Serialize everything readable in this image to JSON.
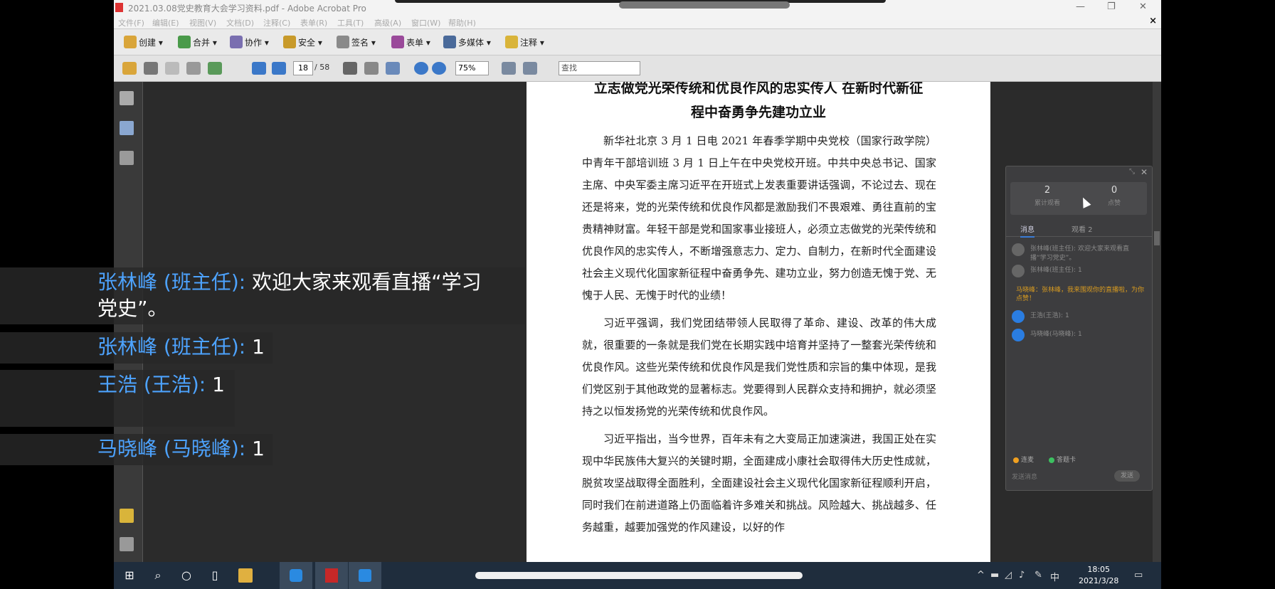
{
  "window": {
    "title": "2021.03.08党史教育大会学习资料.pdf - Adobe Acrobat Pro",
    "min_label": "—",
    "max_label": "❐",
    "close_label": "✕"
  },
  "menubar": {
    "items": [
      "文件(F)",
      "编辑(E)",
      "视图(V)",
      "文档(D)",
      "注释(C)",
      "表单(R)",
      "工具(T)",
      "高级(A)",
      "窗口(W)",
      "帮助(H)"
    ],
    "close_label": "×"
  },
  "toolbar1": {
    "items": [
      {
        "label": "创建 ▾",
        "icon": "create-icon"
      },
      {
        "label": "合并 ▾",
        "icon": "merge-icon"
      },
      {
        "label": "协作 ▾",
        "icon": "collaborate-icon"
      },
      {
        "label": "安全 ▾",
        "icon": "lock-icon"
      },
      {
        "label": "签名 ▾",
        "icon": "pen-icon"
      },
      {
        "label": "表单 ▾",
        "icon": "form-icon"
      },
      {
        "label": "多媒体 ▾",
        "icon": "multimedia-icon"
      },
      {
        "label": "注释 ▾",
        "icon": "comment-icon"
      }
    ]
  },
  "toolbar2": {
    "current_page": "18",
    "total_pages": "/ 58",
    "zoom": "75%",
    "find_placeholder": "查找"
  },
  "document": {
    "title_line1": "立志做党光荣传统和优良作风的忠实传人 在新时代新征",
    "title_line2": "程中奋勇争先建功立业",
    "paragraphs": [
      "新华社北京 3 月 1 日电 2021 年春季学期中央党校（国家行政学院）中青年干部培训班 3 月 1 日上午在中央党校开班。中共中央总书记、国家主席、中央军委主席习近平在开班式上发表重要讲话强调，不论过去、现在还是将来，党的光荣传统和优良作风都是激励我们不畏艰难、勇往直前的宝贵精神财富。年轻干部是党和国家事业接班人，必须立志做党的光荣传统和优良作风的忠实传人，不断增强意志力、定力、自制力，在新时代全面建设社会主义现代化国家新征程中奋勇争先、建功立业，努力创造无愧于党、无愧于人民、无愧于时代的业绩！",
      "习近平强调，我们党团结带领人民取得了革命、建设、改革的伟大成就，很重要的一条就是我们党在长期实践中培育并坚持了一整套光荣传统和优良作风。这些光荣传统和优良作风是我们党性质和宗旨的集中体现，是我们党区别于其他政党的显著标志。党要得到人民群众支持和拥护，就必须坚持之以恒发扬党的光荣传统和优良作风。",
      "习近平指出，当今世界，百年未有之大变局正加速演进，我国正处在实现中华民族伟大复兴的关键时期，全面建成小康社会取得伟大历史性成就，脱贫攻坚战取得全面胜利，全面建设社会主义现代化国家新征程顺利开启，同时我们在前进道路上仍面临着许多难关和挑战。风险越大、挑战越多、任务越重，越要加强党的作风建设，以好的作"
    ]
  },
  "live_panel": {
    "viewers_count": "2",
    "viewers_label": "累计观看",
    "likes_count": "0",
    "likes_label": "点赞",
    "tab_active": "消息",
    "tab_other": "观看 2",
    "messages": [
      {
        "name": "张林峰(班主任):",
        "text": "欢迎大家来观看直播“学习党史”。"
      },
      {
        "name": "张林峰(班主任):",
        "text": "1"
      }
    ],
    "system_message": "马晓峰：张林峰，我来围观你的直播啦，为你点赞！",
    "messages2": [
      {
        "name": "王浩(王浩):",
        "text": "1"
      },
      {
        "name": "马晓峰(马晓峰):",
        "text": "1"
      }
    ],
    "footer_btn1": "连麦",
    "footer_btn2": "答题卡",
    "input_placeholder": "发送消息",
    "send_label": "发送"
  },
  "chat_overlay": [
    {
      "name": "张林峰 (班主任):",
      "text": " 欢迎大家来观看直播“学习",
      "text2": "党史”。"
    },
    {
      "name": "张林峰 (班主任):",
      "text": " 1"
    },
    {
      "name": "王浩 (王浩):",
      "text": " 1"
    },
    {
      "name": "马晓峰 (马晓峰):",
      "text": " 1"
    }
  ],
  "taskbar": {
    "time": "18:05",
    "date": "2021/3/28",
    "ime": "中"
  }
}
